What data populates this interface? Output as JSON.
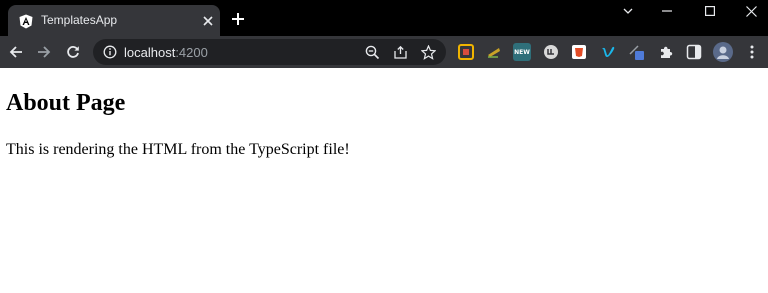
{
  "browser": {
    "tab": {
      "title": "TemplatesApp",
      "favicon": "angular-icon"
    },
    "window_controls": [
      "chevron-down-icon",
      "minimize-icon",
      "maximize-icon",
      "close-icon"
    ],
    "address_bar": {
      "host": "localhost",
      "port": ":4200"
    },
    "toolbar_icons": [
      "back-icon",
      "forward-icon",
      "reload-icon",
      "info-icon",
      "zoom-icon",
      "share-icon",
      "bookmark-star-icon"
    ],
    "extensions": [
      {
        "name": "extension-1-icon",
        "color": "#f0b400"
      },
      {
        "name": "extension-2-icon",
        "color": "#c9a227"
      },
      {
        "name": "extension-3-icon",
        "label": "NEW",
        "color": "#2f6f7a"
      },
      {
        "name": "extension-4-icon",
        "color": "#d9d9d9"
      },
      {
        "name": "extension-5-icon",
        "color": "#e34c26"
      },
      {
        "name": "vimeo-icon",
        "color": "#1ab7ea"
      },
      {
        "name": "extension-7-icon",
        "color": "#4f7bd9"
      },
      {
        "name": "puzzle-extensions-icon",
        "color": "#e8eaed"
      },
      {
        "name": "side-panel-icon",
        "color": "#e8eaed"
      },
      {
        "name": "profile-avatar",
        "color": "#5a6a8a"
      }
    ],
    "menu_icon": "kebab-menu-icon",
    "colors": {
      "tabstrip": "#000000",
      "toolbar": "#35363a",
      "omnibox": "#202124",
      "text": "#e8eaed"
    }
  },
  "page": {
    "heading": "About Page",
    "body_text": "This is rendering the HTML from the TypeScript file!"
  }
}
